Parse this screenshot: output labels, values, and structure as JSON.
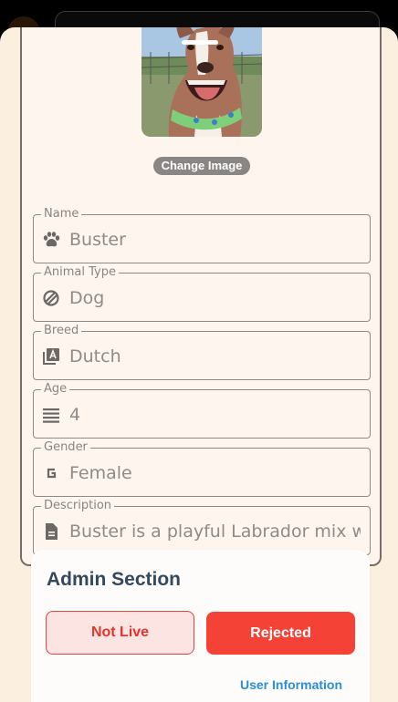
{
  "image": {
    "change_label": "Change Image"
  },
  "fields": [
    {
      "label": "Name",
      "value": "Buster",
      "icon": "paw-icon"
    },
    {
      "label": "Animal Type",
      "value": "Dog",
      "icon": "animal-type-icon"
    },
    {
      "label": "Breed",
      "value": "Dutch",
      "icon": "breed-icon"
    },
    {
      "label": "Age",
      "value": "4",
      "icon": "list-icon"
    },
    {
      "label": "Gender",
      "value": "Female",
      "icon": "letter-g-icon"
    },
    {
      "label": "Description",
      "value": "Buster is a playful Labrador mix wh",
      "icon": "document-icon"
    }
  ],
  "admin": {
    "title": "Admin Section",
    "not_live_label": "Not Live",
    "rejected_label": "Rejected",
    "user_info_label": "User  Information"
  },
  "colors": {
    "sheet_bg": "#fbf0e0",
    "card_bg": "#fdf5ee",
    "danger": "#f44336",
    "link": "#2a8fd8"
  }
}
